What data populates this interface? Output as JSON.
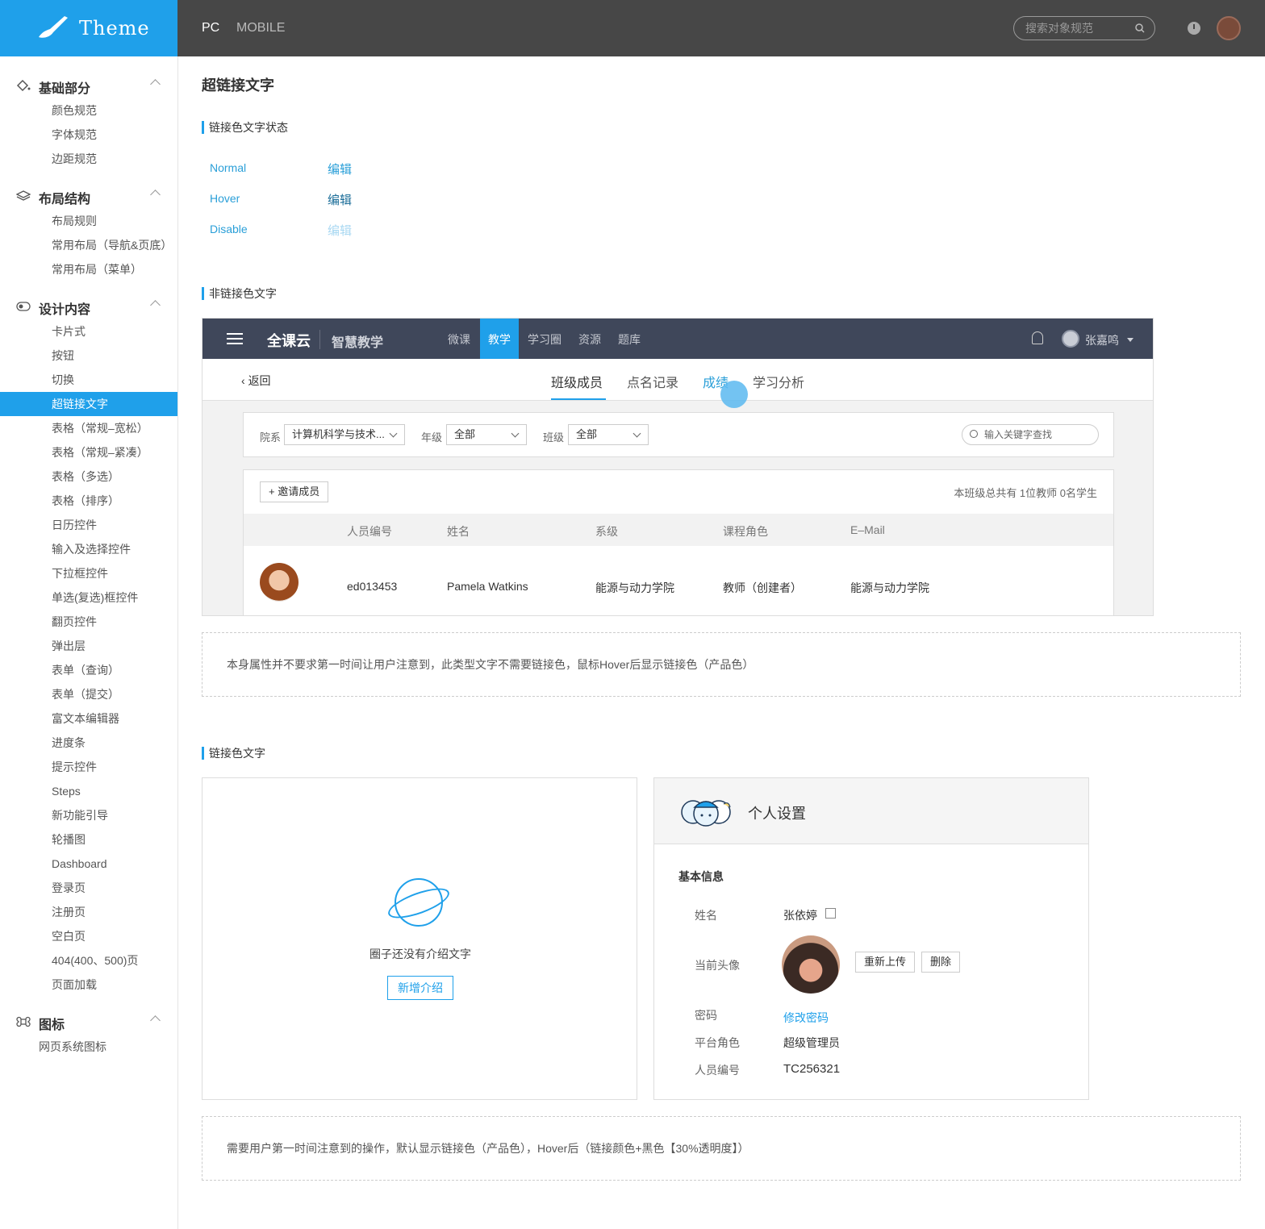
{
  "app": {
    "logo_text": "Theme"
  },
  "topbar": {
    "tabs": [
      "PC",
      "MOBILE"
    ],
    "search_placeholder": "搜索对象规范",
    "icons": [
      "search-icon",
      "clock-icon",
      "user-avatar"
    ]
  },
  "sidebar": {
    "groups": [
      {
        "label": "基础部分",
        "icon": "paint-bucket-icon",
        "items": [
          "颜色规范",
          "字体规范",
          "边距规范"
        ]
      },
      {
        "label": "布局结构",
        "icon": "layers-icon",
        "items": [
          "布局规则",
          "常用布局（导航&页底）",
          "常用布局（菜单）"
        ]
      },
      {
        "label": "设计内容",
        "icon": "toggle-icon",
        "items": [
          "卡片式",
          "按钮",
          "切换",
          "超链接文字",
          "表格（常规–宽松）",
          "表格（常规–紧凑）",
          "表格（多选）",
          "表格（排序）",
          "日历控件",
          "输入及选择控件",
          "下拉框控件",
          "单选(复选)框控件",
          "翻页控件",
          "弹出层",
          "表单（查询）",
          "表单（提交）",
          "富文本编辑器",
          "进度条",
          "提示控件",
          "Steps",
          "新功能引导",
          "轮播图",
          "Dashboard",
          "登录页",
          "注册页",
          "空白页",
          "404(400、500)页",
          "页面加载"
        ]
      },
      {
        "label": "图标",
        "icon": "command-icon",
        "items": [
          "网页系统图标"
        ]
      }
    ],
    "active_item": "超链接文字"
  },
  "page": {
    "title": "超链接文字",
    "section1": {
      "title": "链接色文字状态",
      "states": [
        {
          "label": "Normal",
          "link": "编辑",
          "color": "#2a9fd8"
        },
        {
          "label": "Hover",
          "link": "编辑",
          "color": "#1c6e99"
        },
        {
          "label": "Disable",
          "link": "编辑",
          "color": "#a9d8f2"
        }
      ]
    },
    "section2": {
      "title": "非链接色文字",
      "demo": {
        "brand": "全课云",
        "product": "智慧教学",
        "nav": [
          "微课",
          "教学",
          "学习圈",
          "资源",
          "题库"
        ],
        "nav_active": "教学",
        "username": "张嘉鸣",
        "back": "返回",
        "subtabs": [
          "班级成员",
          "点名记录",
          "成绩",
          "学习分析"
        ],
        "subtab_active": "班级成员",
        "subtab_hover": "成绩",
        "filters": [
          {
            "label": "院系",
            "value": "计算机科学与技术..."
          },
          {
            "label": "年级",
            "value": "全部"
          },
          {
            "label": "班级",
            "value": "全部"
          }
        ],
        "keyword_placeholder": "输入关键字查找",
        "invite": "邀请成员",
        "summary": "本班级总共有 1位教师 0名学生",
        "columns": [
          "人员编号",
          "姓名",
          "系级",
          "课程角色",
          "E–Mail"
        ],
        "row": [
          "ed013453",
          "Pamela Watkins",
          "能源与动力学院",
          "教师（创建者）",
          "能源与动力学院"
        ]
      },
      "note": "本身属性并不要求第一时间让用户注意到，此类型文字不需要链接色，鼠标Hover后显示链接色（产品色）"
    },
    "section3": {
      "title": "链接色文字",
      "empty_card": {
        "message": "圈子还没有介绍文字",
        "button": "新增介绍"
      },
      "profile_card": {
        "title": "个人设置",
        "subtitle": "基本信息",
        "fields": [
          {
            "key": "姓名",
            "value": "张依婷"
          },
          {
            "key": "当前头像",
            "value": ""
          },
          {
            "key": "密码",
            "value": "修改密码"
          },
          {
            "key": "平台角色",
            "value": "超级管理员"
          },
          {
            "key": "人员编号",
            "value": "TC256321"
          }
        ],
        "buttons": [
          "重新上传",
          "删除"
        ]
      },
      "note": "需要用户第一时间注意到的操作，默认显示链接色（产品色），Hover后（链接颜色+黑色【30%透明度】）"
    }
  }
}
